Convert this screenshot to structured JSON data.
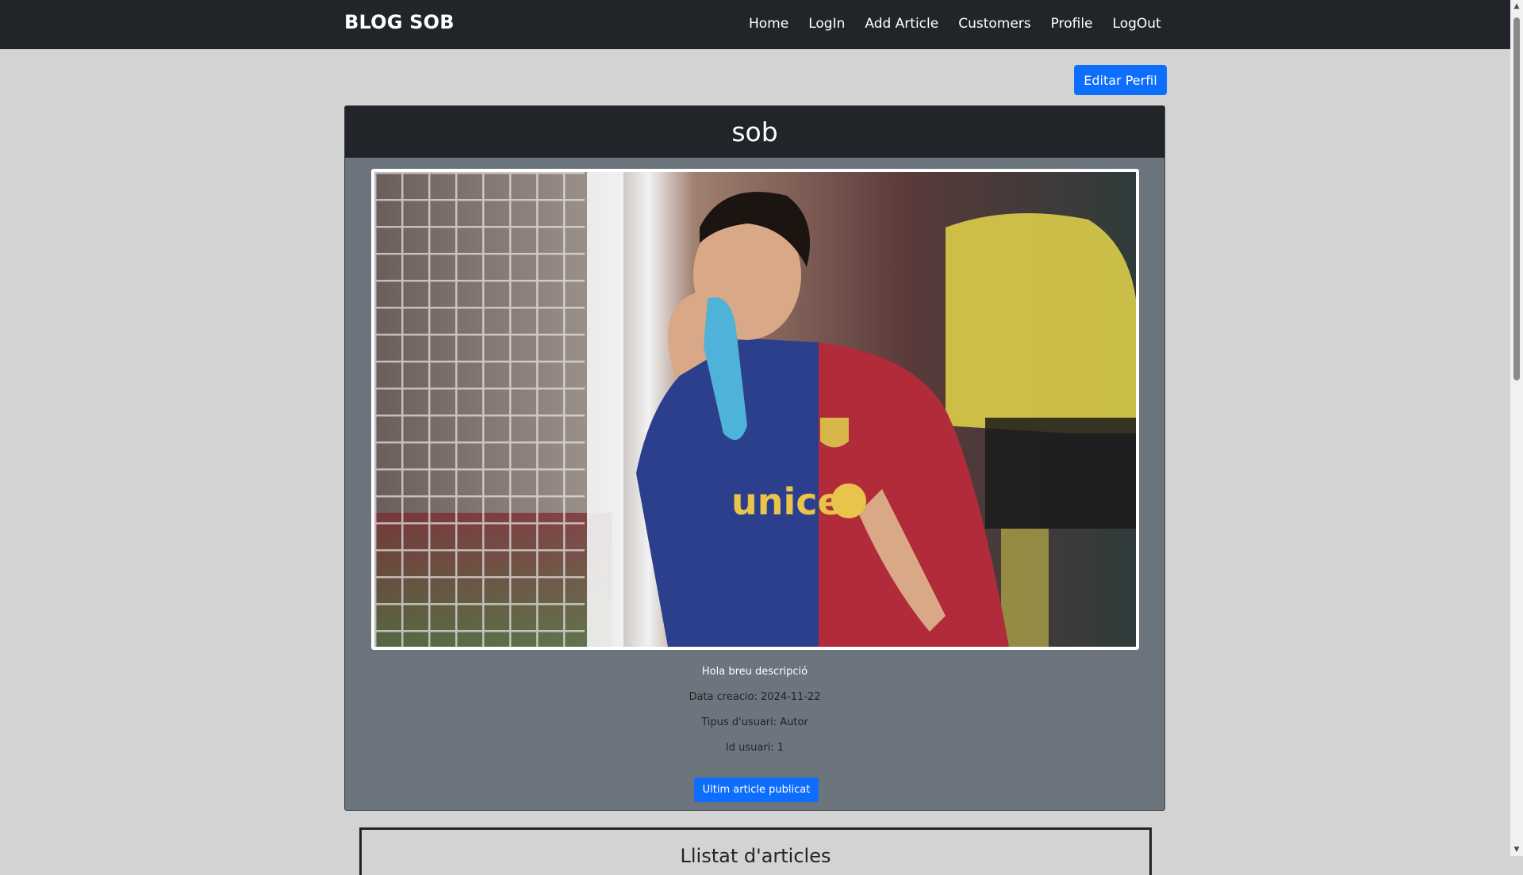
{
  "navbar": {
    "brand": "BLOG SOB",
    "links": [
      "Home",
      "LogIn",
      "Add Article",
      "Customers",
      "Profile",
      "LogOut"
    ]
  },
  "edit_button": "Editar Perfil",
  "profile": {
    "username": "sob",
    "photo_alt": "Football player kissing boot",
    "description": "Hola breu descripció",
    "created": "Data creacio: 2024-11-22",
    "user_type": "Tipus d'usuari: Autor",
    "user_id": "Id usuari: 1",
    "last_article_button": "Ultim article publicat"
  },
  "articles_section": {
    "title": "Llistat d'articles"
  },
  "colors": {
    "navbar": "#212529",
    "page_bg": "#d3d3d3",
    "card_bg": "#6c757d",
    "primary": "#0d6efd"
  },
  "icons": {
    "scroll_up": "▲",
    "scroll_down": "▼"
  }
}
